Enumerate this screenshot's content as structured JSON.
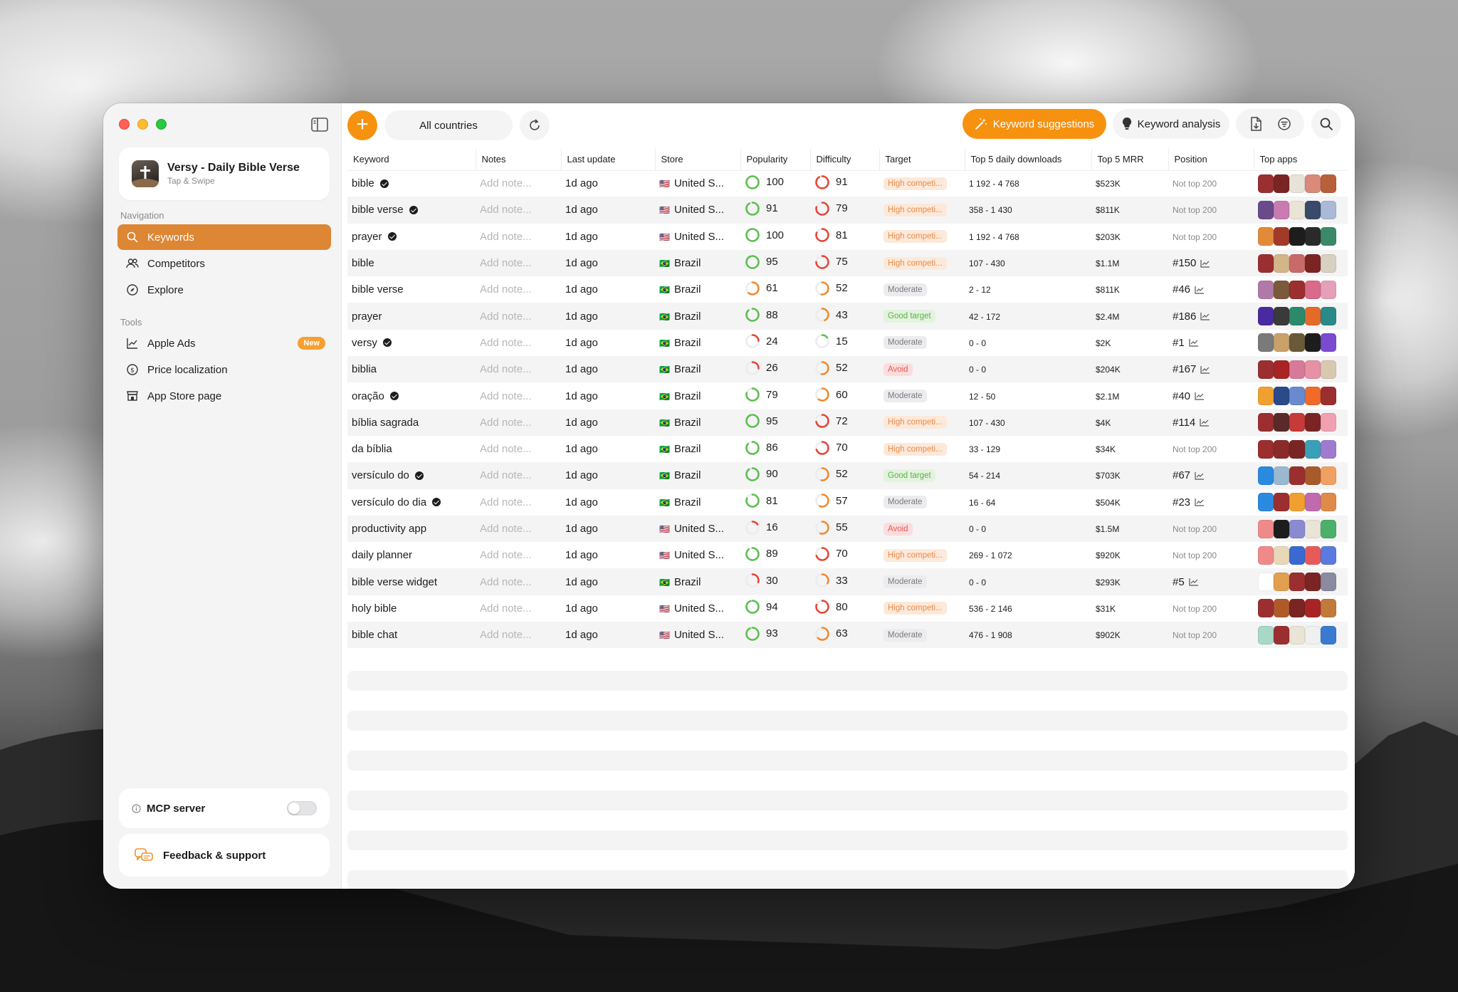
{
  "sidebar": {
    "app_name": "Versy - Daily Bible Verse",
    "app_subtitle": "Tap & Swipe",
    "navigation_title": "Navigation",
    "nav": [
      {
        "label": "Keywords",
        "icon": "search-icon",
        "active": true
      },
      {
        "label": "Competitors",
        "icon": "users-icon"
      },
      {
        "label": "Explore",
        "icon": "compass-icon"
      }
    ],
    "tools_title": "Tools",
    "tools": [
      {
        "label": "Apple Ads",
        "icon": "chart-icon",
        "badge": "New"
      },
      {
        "label": "Price localization",
        "icon": "dollar-icon"
      },
      {
        "label": "App Store page",
        "icon": "store-icon"
      }
    ],
    "mcp_label": "MCP server",
    "feedback_label": "Feedback & support"
  },
  "toolbar": {
    "add": "+",
    "countries": "All countries",
    "keyword_suggestions": "Keyword suggestions",
    "keyword_analysis": "Keyword analysis"
  },
  "colors": {
    "accent": "#f6920f",
    "active_nav": "#dd8633",
    "ring_green": "#5cbf4f",
    "ring_orange": "#f08a2e",
    "ring_red": "#e5463a"
  },
  "table": {
    "headers": [
      "Keyword",
      "Notes",
      "Last update",
      "Store",
      "Popularity",
      "Difficulty",
      "Target",
      "Top 5 daily downloads",
      "Top 5 MRR",
      "Position",
      "Top apps"
    ],
    "note_placeholder": "Add note...",
    "rows": [
      {
        "keyword": "bible",
        "verified": true,
        "updated": "1d ago",
        "store": "United S...",
        "flag": "🇺🇸",
        "pop": 100,
        "diff": 91,
        "target": "High competi...",
        "tclass": "t-high",
        "downloads": "1 192 - 4 768",
        "mrr": "$523K",
        "position": "Not top 200",
        "chart": false
      },
      {
        "keyword": "bible verse",
        "verified": true,
        "updated": "1d ago",
        "store": "United S...",
        "flag": "🇺🇸",
        "pop": 91,
        "diff": 79,
        "target": "High competi...",
        "tclass": "t-high",
        "downloads": "358 - 1 430",
        "mrr": "$811K",
        "position": "Not top 200",
        "chart": false
      },
      {
        "keyword": "prayer",
        "verified": true,
        "updated": "1d ago",
        "store": "United S...",
        "flag": "🇺🇸",
        "pop": 100,
        "diff": 81,
        "target": "High competi...",
        "tclass": "t-high",
        "downloads": "1 192 - 4 768",
        "mrr": "$203K",
        "position": "Not top 200",
        "chart": false
      },
      {
        "keyword": "bible",
        "verified": false,
        "updated": "1d ago",
        "store": "Brazil",
        "flag": "🇧🇷",
        "pop": 95,
        "diff": 75,
        "target": "High competi...",
        "tclass": "t-high",
        "downloads": "107 - 430",
        "mrr": "$1.1M",
        "position": "#150",
        "chart": true
      },
      {
        "keyword": "bible verse",
        "verified": false,
        "updated": "1d ago",
        "store": "Brazil",
        "flag": "🇧🇷",
        "pop": 61,
        "diff": 52,
        "target": "Moderate",
        "tclass": "t-mod",
        "downloads": "2 - 12",
        "mrr": "$811K",
        "position": "#46",
        "chart": true
      },
      {
        "keyword": "prayer",
        "verified": false,
        "updated": "1d ago",
        "store": "Brazil",
        "flag": "🇧🇷",
        "pop": 88,
        "diff": 43,
        "target": "Good target",
        "tclass": "t-good",
        "downloads": "42 - 172",
        "mrr": "$2.4M",
        "position": "#186",
        "chart": true
      },
      {
        "keyword": "versy",
        "verified": true,
        "updated": "1d ago",
        "store": "Brazil",
        "flag": "🇧🇷",
        "pop": 24,
        "diff": 15,
        "target": "Moderate",
        "tclass": "t-mod",
        "downloads": "0 - 0",
        "mrr": "$2K",
        "position": "#1",
        "chart": true
      },
      {
        "keyword": "biblia",
        "verified": false,
        "updated": "1d ago",
        "store": "Brazil",
        "flag": "🇧🇷",
        "pop": 26,
        "diff": 52,
        "target": "Avoid",
        "tclass": "t-avoid",
        "downloads": "0 - 0",
        "mrr": "$204K",
        "position": "#167",
        "chart": true
      },
      {
        "keyword": "oração",
        "verified": true,
        "updated": "1d ago",
        "store": "Brazil",
        "flag": "🇧🇷",
        "pop": 79,
        "diff": 60,
        "target": "Moderate",
        "tclass": "t-mod",
        "downloads": "12 - 50",
        "mrr": "$2.1M",
        "position": "#40",
        "chart": true
      },
      {
        "keyword": "bíblia sagrada",
        "verified": false,
        "updated": "1d ago",
        "store": "Brazil",
        "flag": "🇧🇷",
        "pop": 95,
        "diff": 72,
        "target": "High competi...",
        "tclass": "t-high",
        "downloads": "107 - 430",
        "mrr": "$4K",
        "position": "#114",
        "chart": true
      },
      {
        "keyword": "da bíblia",
        "verified": false,
        "updated": "1d ago",
        "store": "Brazil",
        "flag": "🇧🇷",
        "pop": 86,
        "diff": 70,
        "target": "High competi...",
        "tclass": "t-high",
        "downloads": "33 - 129",
        "mrr": "$34K",
        "position": "Not top 200",
        "chart": false
      },
      {
        "keyword": "versículo do",
        "verified": true,
        "updated": "1d ago",
        "store": "Brazil",
        "flag": "🇧🇷",
        "pop": 90,
        "diff": 52,
        "target": "Good target",
        "tclass": "t-good",
        "downloads": "54 - 214",
        "mrr": "$703K",
        "position": "#67",
        "chart": true
      },
      {
        "keyword": "versículo do dia",
        "verified": true,
        "updated": "1d ago",
        "store": "Brazil",
        "flag": "🇧🇷",
        "pop": 81,
        "diff": 57,
        "target": "Moderate",
        "tclass": "t-mod",
        "downloads": "16 - 64",
        "mrr": "$504K",
        "position": "#23",
        "chart": true
      },
      {
        "keyword": "productivity app",
        "verified": false,
        "updated": "1d ago",
        "store": "United S...",
        "flag": "🇺🇸",
        "pop": 16,
        "diff": 55,
        "target": "Avoid",
        "tclass": "t-avoid",
        "downloads": "0 - 0",
        "mrr": "$1.5M",
        "position": "Not top 200",
        "chart": false
      },
      {
        "keyword": "daily planner",
        "verified": false,
        "updated": "1d ago",
        "store": "United S...",
        "flag": "🇺🇸",
        "pop": 89,
        "diff": 70,
        "target": "High competi...",
        "tclass": "t-high",
        "downloads": "269 - 1 072",
        "mrr": "$920K",
        "position": "Not top 200",
        "chart": false
      },
      {
        "keyword": "bible verse widget",
        "verified": false,
        "updated": "1d ago",
        "store": "Brazil",
        "flag": "🇧🇷",
        "pop": 30,
        "diff": 33,
        "target": "Moderate",
        "tclass": "t-mod",
        "downloads": "0 - 0",
        "mrr": "$293K",
        "position": "#5",
        "chart": true
      },
      {
        "keyword": "holy bible",
        "verified": false,
        "updated": "1d ago",
        "store": "United S...",
        "flag": "🇺🇸",
        "pop": 94,
        "diff": 80,
        "target": "High competi...",
        "tclass": "t-high",
        "downloads": "536 - 2 146",
        "mrr": "$31K",
        "position": "Not top 200",
        "chart": false
      },
      {
        "keyword": "bible chat",
        "verified": false,
        "updated": "1d ago",
        "store": "United S...",
        "flag": "🇺🇸",
        "pop": 93,
        "diff": 63,
        "target": "Moderate",
        "tclass": "t-mod",
        "downloads": "476 - 1 908",
        "mrr": "$902K",
        "position": "Not top 200",
        "chart": false
      }
    ]
  },
  "app_icon_colors": [
    [
      "#9b2f2f",
      "#7a2424",
      "#e7e3d8",
      "#d98a7a",
      "#b8603a"
    ],
    [
      "#6a4a8a",
      "#c87bb0",
      "#e9e4d6",
      "#3a4a6a",
      "#a9b9d6"
    ],
    [
      "#e38a3a",
      "#a23a2a",
      "#1d1d1d",
      "#2a2a2a",
      "#3a8a6a"
    ],
    [
      "#9b2f2f",
      "#d4b58a",
      "#c96a6a",
      "#7a2424",
      "#d8d0c0"
    ],
    [
      "#b07aa8",
      "#7a5a3a",
      "#9b2f2f",
      "#d96a8a",
      "#e4a0b8"
    ],
    [
      "#4a2aa0",
      "#3a3a3a",
      "#2a8a6a",
      "#e56a2a",
      "#2a8a8a"
    ],
    [
      "#7a7a7a",
      "#c9a06a",
      "#6a5a3a",
      "#1d1d1d",
      "#7a4ad0"
    ],
    [
      "#9b2f2f",
      "#a82424",
      "#d77a9a",
      "#e790a6",
      "#d9c8b0"
    ],
    [
      "#f0a030",
      "#2a4a8a",
      "#6a8ad0",
      "#f06a2a",
      "#9b2f2f"
    ],
    [
      "#9b2f2f",
      "#5a2a2a",
      "#c73a3a",
      "#7a2424",
      "#f0a0b0"
    ],
    [
      "#9b2f2f",
      "#8a2a2a",
      "#7a2424",
      "#3aa0b8",
      "#a07ad0"
    ],
    [
      "#2a8ae0",
      "#9ab8d0",
      "#9b2f2f",
      "#a85a2a",
      "#f0a060"
    ],
    [
      "#2a8ae0",
      "#9b2f2f",
      "#f0a030",
      "#c06ab0",
      "#e08a4a"
    ],
    [
      "#f08a8a",
      "#1d1d1d",
      "#8a8ad0",
      "#e9e4d6",
      "#4ab06a"
    ],
    [
      "#f08a8a",
      "#e9d8b8",
      "#3a6ad0",
      "#e85a5a",
      "#5a7ae0"
    ],
    [
      "#ffffff",
      "#e0a050",
      "#9b2f2f",
      "#7a2424",
      "#8a8aa0"
    ],
    [
      "#9b2f2f",
      "#b05a2a",
      "#7a2424",
      "#a82424",
      "#c07a3a"
    ],
    [
      "#a8d8c8",
      "#9b2f2f",
      "#e9e4d6",
      "#f0f0f0",
      "#3a7ad0"
    ]
  ]
}
